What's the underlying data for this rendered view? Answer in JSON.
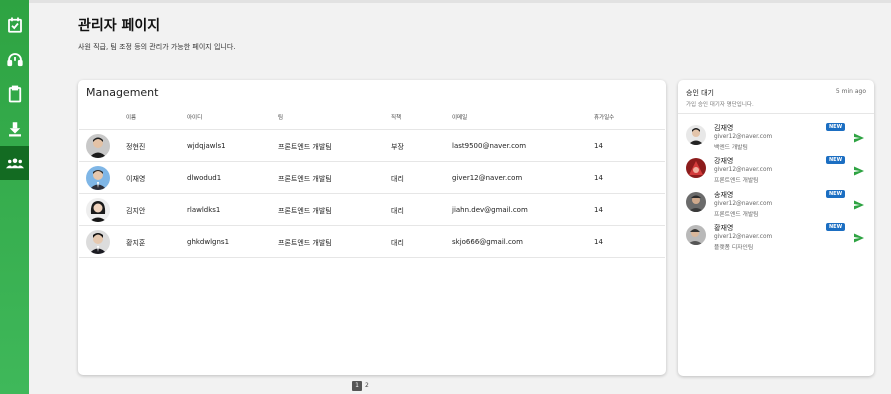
{
  "sidebar": {
    "items": [
      {
        "icon": "calendar-check-icon"
      },
      {
        "icon": "headset-icon"
      },
      {
        "icon": "clipboard-icon"
      },
      {
        "icon": "download-icon"
      },
      {
        "icon": "users-icon",
        "active": true
      }
    ]
  },
  "header": {
    "title": "관리자 페이지",
    "description": "사원 직급, 팀 조정 등의 관리가 가능한 페이지 입니다."
  },
  "management": {
    "title": "Management",
    "columns": [
      "이름",
      "아이디",
      "팀",
      "직책",
      "이메일",
      "휴가일수"
    ],
    "rows": [
      {
        "name": "정현진",
        "id": "wjdqjawls1",
        "team": "프론트엔드 개발팀",
        "position": "부장",
        "email": "last9500@naver.com",
        "vacation": "14"
      },
      {
        "name": "이재영",
        "id": "dlwodud1",
        "team": "프론트엔드 개발팀",
        "position": "대리",
        "email": "giver12@naver.com",
        "vacation": "14"
      },
      {
        "name": "김지안",
        "id": "rlawldks1",
        "team": "프론트엔드 개발팀",
        "position": "대리",
        "email": "jiahn.dev@gmail.com",
        "vacation": "14"
      },
      {
        "name": "황지훈",
        "id": "ghkdwlgns1",
        "team": "프론트엔드 개발팀",
        "position": "대리",
        "email": "skjo666@gmail.com",
        "vacation": "14"
      }
    ]
  },
  "pending": {
    "title": "승인 대기",
    "time_ago": "5 min ago",
    "subtitle": "가입 승인 대기자 명단입니다.",
    "badge": "NEW",
    "requests": [
      {
        "name": "김재영",
        "email": "giver12@naver.com",
        "team": "백엔드 개발팀"
      },
      {
        "name": "강재영",
        "email": "giver12@naver.com",
        "team": "프론트엔드 개발팀"
      },
      {
        "name": "송재영",
        "email": "giver12@naver.com",
        "team": "프론트엔드 개발팀"
      },
      {
        "name": "황재영",
        "email": "giver12@naver.com",
        "team": "플랫폼 디자인팀"
      }
    ]
  },
  "pagination": {
    "pages": [
      "1",
      "2"
    ],
    "current": "1"
  },
  "colors": {
    "sidebar": "#2ea342",
    "sidebar_active": "#136b22",
    "badge": "#1b6ec2",
    "send": "#2ea342"
  }
}
